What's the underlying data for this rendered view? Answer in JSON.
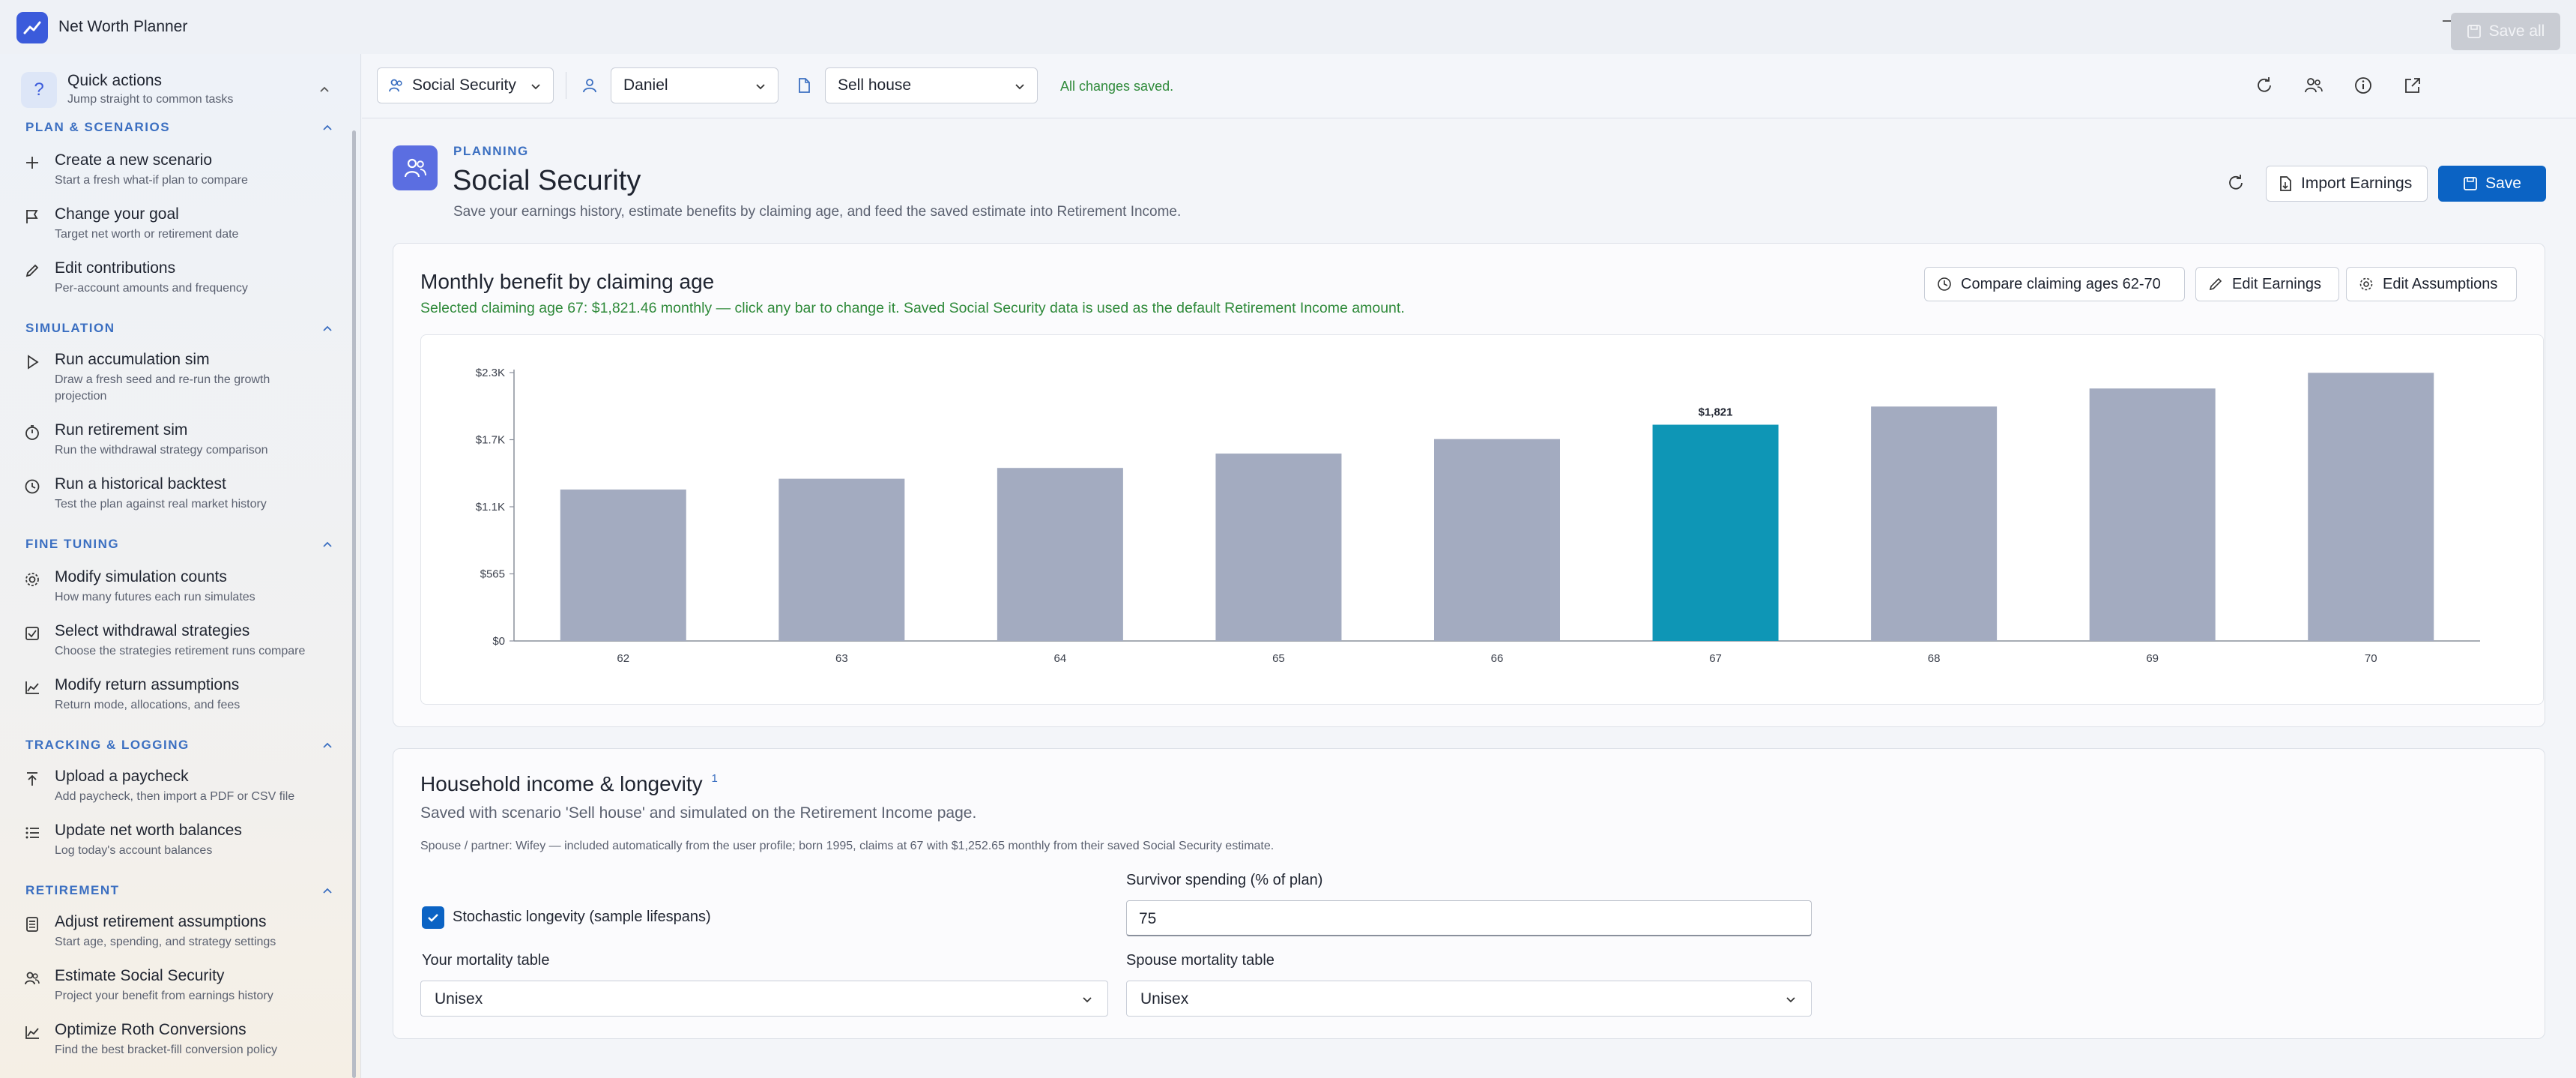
{
  "app": {
    "title": "Net Worth Planner"
  },
  "sidebar": {
    "quick_actions": {
      "title": "Quick actions",
      "subtitle": "Jump straight to common tasks"
    },
    "sections": [
      {
        "label": "PLAN & SCENARIOS",
        "items": [
          {
            "title": "Create a new scenario",
            "subtitle": "Start a fresh what-if plan to compare",
            "icon": "plus-icon"
          },
          {
            "title": "Change your goal",
            "subtitle": "Target net worth or retirement date",
            "icon": "flag-icon"
          },
          {
            "title": "Edit contributions",
            "subtitle": "Per-account amounts and frequency",
            "icon": "pencil-icon"
          }
        ]
      },
      {
        "label": "SIMULATION",
        "items": [
          {
            "title": "Run accumulation sim",
            "subtitle": "Draw a fresh seed and re-run the growth projection",
            "icon": "play-icon"
          },
          {
            "title": "Run retirement sim",
            "subtitle": "Run the withdrawal strategy comparison",
            "icon": "stopwatch-icon"
          },
          {
            "title": "Run a historical backtest",
            "subtitle": "Test the plan against real market history",
            "icon": "clock-icon"
          }
        ]
      },
      {
        "label": "FINE TUNING",
        "items": [
          {
            "title": "Modify simulation counts",
            "subtitle": "How many futures each run simulates",
            "icon": "gear-icon"
          },
          {
            "title": "Select withdrawal strategies",
            "subtitle": "Choose the strategies retirement runs compare",
            "icon": "checkbox-icon"
          },
          {
            "title": "Modify return assumptions",
            "subtitle": "Return mode, allocations, and fees",
            "icon": "area-chart-icon"
          }
        ]
      },
      {
        "label": "TRACKING & LOGGING",
        "items": [
          {
            "title": "Upload a paycheck",
            "subtitle": "Add paycheck, then import a PDF or CSV file",
            "icon": "upload-icon"
          },
          {
            "title": "Update net worth balances",
            "subtitle": "Log today's account balances",
            "icon": "list-icon"
          }
        ]
      },
      {
        "label": "RETIREMENT",
        "items": [
          {
            "title": "Adjust retirement assumptions",
            "subtitle": "Start age, spending, and strategy settings",
            "icon": "calculator-icon"
          },
          {
            "title": "Estimate Social Security",
            "subtitle": "Project your benefit from earnings history",
            "icon": "people-icon"
          },
          {
            "title": "Optimize Roth Conversions",
            "subtitle": "Find the best bracket-fill conversion policy",
            "icon": "area-chart-icon"
          }
        ]
      }
    ]
  },
  "toolbar": {
    "page_select": "Social Security",
    "person_select": "Daniel",
    "scenario_select": "Sell house",
    "status": "All changes saved.",
    "save_all": "Save all"
  },
  "page": {
    "kicker": "PLANNING",
    "title": "Social Security",
    "subtitle": "Save your earnings history, estimate benefits by claiming age, and feed the saved estimate into Retirement Income.",
    "import_label": "Import Earnings",
    "save_label": "Save"
  },
  "benefit_card": {
    "title": "Monthly benefit by claiming age",
    "note": "Selected claiming age 67: $1,821.46 monthly — click any bar to change it. Saved Social Security data is used as the default Retirement Income amount.",
    "compare_label": "Compare claiming ages 62-70",
    "edit_earnings_label": "Edit Earnings",
    "edit_assumptions_label": "Edit Assumptions"
  },
  "chart_data": {
    "type": "bar",
    "categories": [
      "62",
      "63",
      "64",
      "65",
      "66",
      "67",
      "68",
      "69",
      "70"
    ],
    "values": [
      1275,
      1366,
      1457,
      1578,
      1700,
      1821,
      1974,
      2126,
      2258
    ],
    "ytick_labels": [
      "$0",
      "$565",
      "$1.1K",
      "$1.7K",
      "$2.3K"
    ],
    "ytick_values": [
      0,
      565,
      1130,
      1695,
      2260
    ],
    "ylim": [
      0,
      2260
    ],
    "selected_index": 5,
    "selected_label": "$1,821",
    "colors": {
      "bar": "#a3abc0",
      "selected": "#0e96b6"
    },
    "title": "",
    "xlabel": "",
    "ylabel": "",
    "grid": false
  },
  "household": {
    "title": "Household income & longevity",
    "superscript": "1",
    "subtitle": "Saved with scenario 'Sell house' and simulated on the Retirement Income page.",
    "note": "Spouse / partner: Wifey — included automatically from the user profile; born 1995, claims at 67 with $1,252.65 monthly from their saved Social Security estimate.",
    "stochastic_label": "Stochastic longevity (sample lifespans)",
    "stochastic_checked": true,
    "survivor_label": "Survivor spending (% of plan)",
    "survivor_value": "75",
    "your_mortality_label": "Your mortality table",
    "your_mortality_value": "Unisex",
    "spouse_mortality_label": "Spouse mortality table",
    "spouse_mortality_value": "Unisex"
  }
}
